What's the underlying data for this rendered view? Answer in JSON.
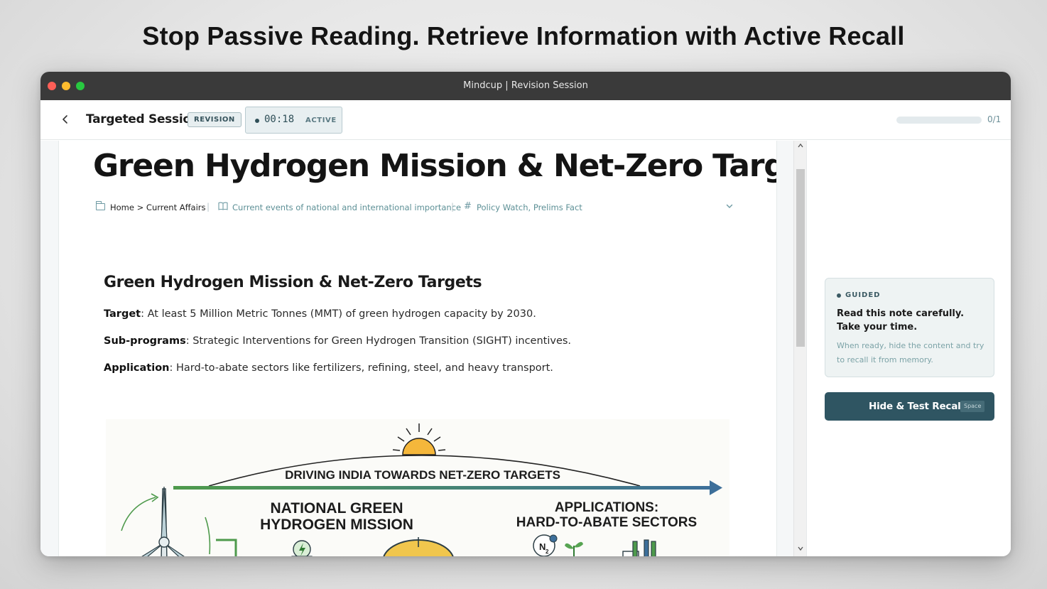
{
  "banner": {
    "headline": "Stop Passive Reading. Retrieve Information with Active Recall"
  },
  "window": {
    "title": "Mindcup | Revision Session"
  },
  "topbar": {
    "back_icon": "chevron-left-icon",
    "session_title": "Targeted Session",
    "badge": "REVISION",
    "timer": {
      "time": "00:18",
      "status": "ACTIVE"
    },
    "progress": {
      "fraction": 0,
      "label": "0/1"
    }
  },
  "note": {
    "title": "Green Hydrogen Mission & Net-Zero Targ",
    "meta": {
      "breadcrumb": "Home > Current Affairs",
      "syllabus": "Current events of national and international importance",
      "tags": "Policy Watch, Prelims Fact"
    },
    "section_title": "Green Hydrogen Mission & Net-Zero Targets",
    "points": [
      {
        "label": "Target",
        "text": ": At least 5 Million Metric Tonnes (MMT) of green hydrogen capacity by 2030."
      },
      {
        "label": "Sub-programs",
        "text": ": Strategic Interventions for Green Hydrogen Transition (SIGHT) incentives."
      },
      {
        "label": "Application",
        "text": ": Hard-to-abate sectors like fertilizers, refining, steel, and heavy transport."
      }
    ],
    "figure": {
      "banner": "DRIVING INDIA TOWARDS NET-ZERO TARGETS",
      "left_heading_1": "NATIONAL GREEN",
      "left_heading_2": "HYDROGEN MISSION",
      "right_heading_1": "APPLICATIONS:",
      "right_heading_2": "HARD-TO-ABATE SECTORS",
      "molecule_label": "N",
      "molecule_sub": "2"
    }
  },
  "sidebar": {
    "guide": {
      "label": "GUIDED",
      "main": "Read this note carefully. Take your time.",
      "sub": "When ready, hide the content and try to recall it from memory."
    },
    "recall_button": {
      "label": "Hide & Test Recall",
      "shortcut": "Space"
    }
  },
  "colors": {
    "accent": "#2f5562",
    "muted_teal": "#6e9aa3",
    "titlebar": "#3a3a3a"
  }
}
